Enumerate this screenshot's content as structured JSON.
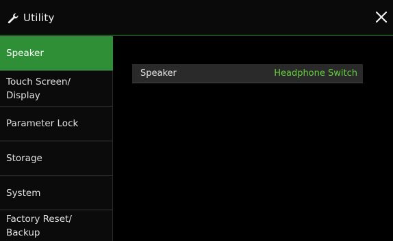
{
  "title": "Utility",
  "sidebar": {
    "items": [
      {
        "label": "Speaker",
        "active": true
      },
      {
        "label": "Touch Screen/\nDisplay",
        "active": false
      },
      {
        "label": "Parameter Lock",
        "active": false
      },
      {
        "label": "Storage",
        "active": false
      },
      {
        "label": "System",
        "active": false
      },
      {
        "label": "Factory Reset/\nBackup",
        "active": false
      }
    ]
  },
  "main": {
    "rows": [
      {
        "label": "Speaker",
        "value": "Headphone Switch"
      }
    ]
  },
  "colors": {
    "accent": "#2f8f36",
    "value_text": "#64d13d",
    "background": "#000000"
  },
  "icons": {
    "title": "wrench-icon",
    "close": "close-icon"
  }
}
